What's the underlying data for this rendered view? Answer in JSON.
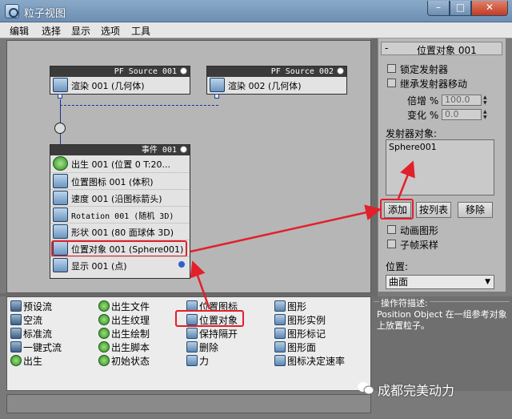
{
  "window": {
    "title": "粒子视图",
    "min": "–",
    "max": "□",
    "close": "✕"
  },
  "menu": [
    "编辑",
    "选择",
    "显示",
    "选项",
    "工具"
  ],
  "nodes": {
    "source1": {
      "header": "PF Source 001",
      "row": "渲染 001 (几何体)"
    },
    "source2": {
      "header": "PF Source 002",
      "row": "渲染 002 (几何体)"
    },
    "event": {
      "header": "事件 001",
      "rows": [
        "出生 001 (位置 0 T:20...",
        "位置图标 001 (体积)",
        "速度 001 (沿图标箭头)",
        "Rotation 001 (随机 3D)",
        "形状 001 (80 面球体 3D)",
        "位置对象 001 (Sphere001)",
        "显示 001 (点)"
      ]
    }
  },
  "panel": {
    "rollout_title": "位置对象 001",
    "rollout_toggle": "-",
    "lock_emitter": "锁定发射器",
    "inherit_motion": "继承发射器移动",
    "multiplier_label": "倍增 %",
    "multiplier_value": "100.0",
    "variation_label": "变化 %",
    "variation_value": "0.0",
    "emitter_objects_label": "发射器对象:",
    "emitter_objects": [
      "Sphere001"
    ],
    "add_button": "添加",
    "by_list_button": "按列表",
    "remove_button": "移除",
    "animated_shape": "动画图形",
    "subframe_sampling": "子帧采样",
    "location_label": "位置:",
    "location_value": "曲面"
  },
  "depot": [
    [
      "预设流",
      "空流",
      "标准流",
      "一键式流",
      "出生"
    ],
    [
      "出生文件",
      "出生纹理",
      "出生绘制",
      "出生脚本",
      "初始状态"
    ],
    [
      "位置图标",
      "位置对象",
      "保持隔开",
      "删除",
      "力"
    ],
    [
      "图形",
      "图形实例",
      "图形标记",
      "图形面",
      "图标决定速率"
    ]
  ],
  "description": {
    "title": "操作符描述:",
    "body": "Position Object 在一组参考对象上放置粒子。"
  },
  "watermark": "成都完美动力",
  "colors": {
    "highlight": "#e2202b",
    "wire": "#1a2f9c",
    "title_bar": "#7a99bd"
  }
}
